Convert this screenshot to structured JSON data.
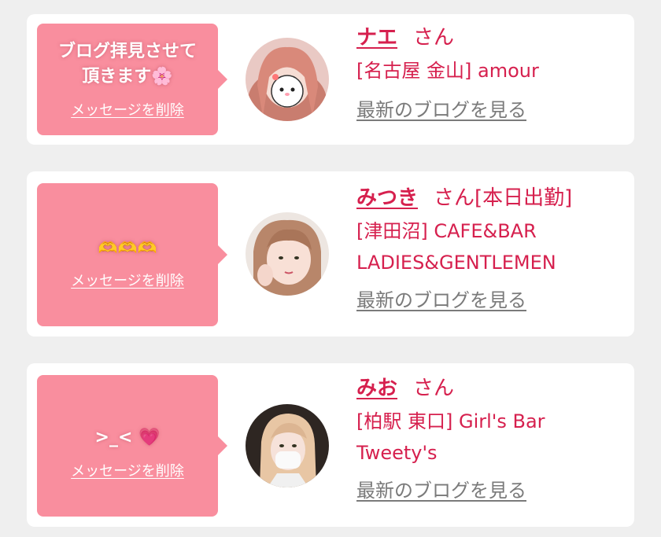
{
  "colors": {
    "accent": "#d6204e",
    "bubble": "#f98e9e",
    "link_gray": "#7a7a7a",
    "background": "#efefef"
  },
  "entries": [
    {
      "message": "ブログ拝見させて頂きます🌸",
      "message_line1": "ブログ拝見させて",
      "message_line2": "頂きます",
      "message_emoji": "🌸",
      "delete_label": "メッセージを削除",
      "name": "ナエ",
      "honorific": "さん",
      "status": "",
      "shop_lines": [
        "[名古屋 金山] amour"
      ],
      "blog_link": "最新のブログを見る"
    },
    {
      "message": "🫶🫶🫶",
      "delete_label": "メッセージを削除",
      "name": "みつき",
      "honorific": "さん",
      "status": "[本日出勤]",
      "shop_lines": [
        "[津田沼] CAFE&BAR",
        "LADIES&GENTLEMEN"
      ],
      "blog_link": "最新のブログを見る"
    },
    {
      "message": ">_< 💗",
      "message_text": ">_<",
      "message_emoji": "💗",
      "delete_label": "メッセージを削除",
      "name": "みお",
      "honorific": "さん",
      "status": "",
      "shop_lines": [
        "[柏駅 東口] Girl's Bar",
        "Tweety's"
      ],
      "blog_link": "最新のブログを見る"
    }
  ]
}
